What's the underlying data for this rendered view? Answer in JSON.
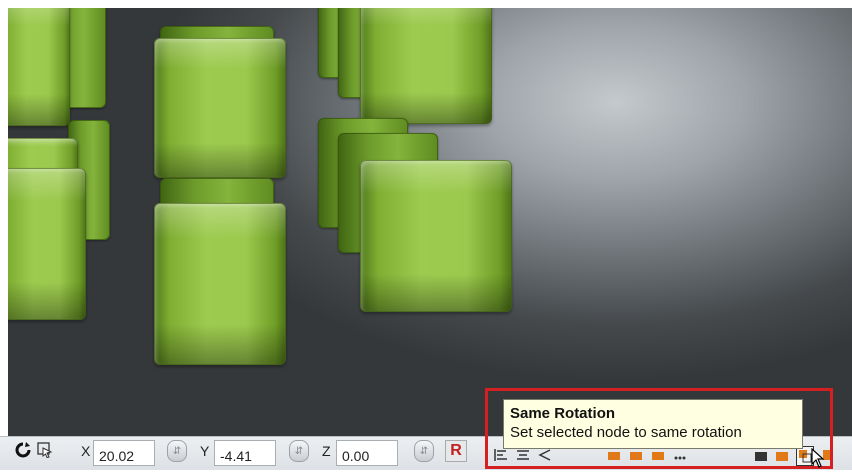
{
  "viewport": {
    "background": "#6e7478",
    "cube_color": "#9ccb4f"
  },
  "statusbar": {
    "rotate_icon": "rotate-icon",
    "select_icon": "select-node-icon",
    "x_label": "X",
    "x_value": "20.02",
    "y_label": "Y",
    "y_value": "-4.41",
    "z_label": "Z",
    "z_value": "0.00",
    "reset_label": "R"
  },
  "tooltip": {
    "title": "Same Rotation",
    "description": "Set selected node to same rotation"
  },
  "toolbar_icons": [
    "align-left-icon",
    "distribute-icon",
    "snap-icon",
    "align-orange-1-icon",
    "align-orange-2-icon",
    "align-orange-3-icon",
    "spread-icon",
    "block-icon",
    "node-orange-icon",
    "same-rotation-icon",
    "same-scale-icon"
  ],
  "colors": {
    "highlight": "#d42020",
    "tooltip_bg": "#ffffe1",
    "reset_red": "#c0201f",
    "icon_orange": "#e07a18"
  }
}
